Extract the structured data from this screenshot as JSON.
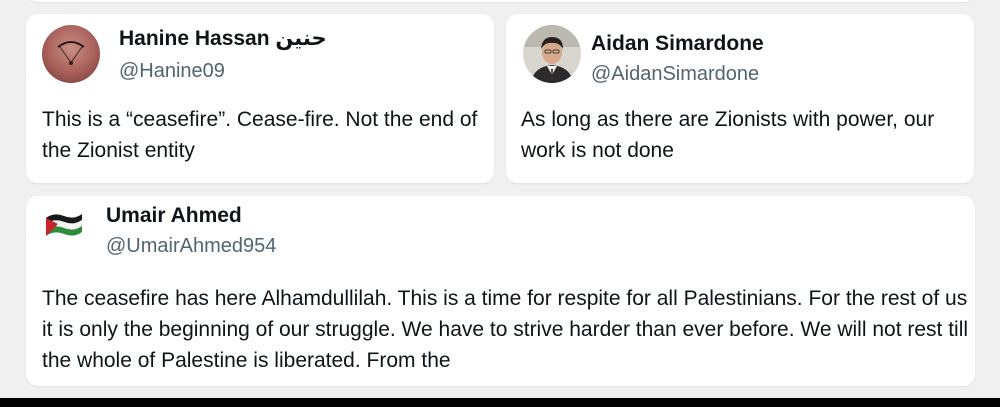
{
  "posts": [
    {
      "name": "Hanine Hassan حنين",
      "handle": "@Hanine09",
      "text": "This is a “ceasefire”. Cease-fire. Not the end of the Zionist entity"
    },
    {
      "name": "Aidan Simardone",
      "handle": "@AidanSimardone",
      "text": "As long as there are Zionists with power, our work is not done"
    },
    {
      "name": "Umair Ahmed",
      "handle": "@UmairAhmed954",
      "text": "The ceasefire has here Alhamdullilah. This is a time for respite for all Palestinians. For the rest of us it is only the beginning of our struggle. We have to strive harder than ever before. We will not rest till the whole of Palestine is liberated. From the"
    }
  ],
  "colors": {
    "background": "#f0f0f0",
    "card": "#ffffff",
    "text": "#0f1419",
    "handle": "#536471"
  }
}
